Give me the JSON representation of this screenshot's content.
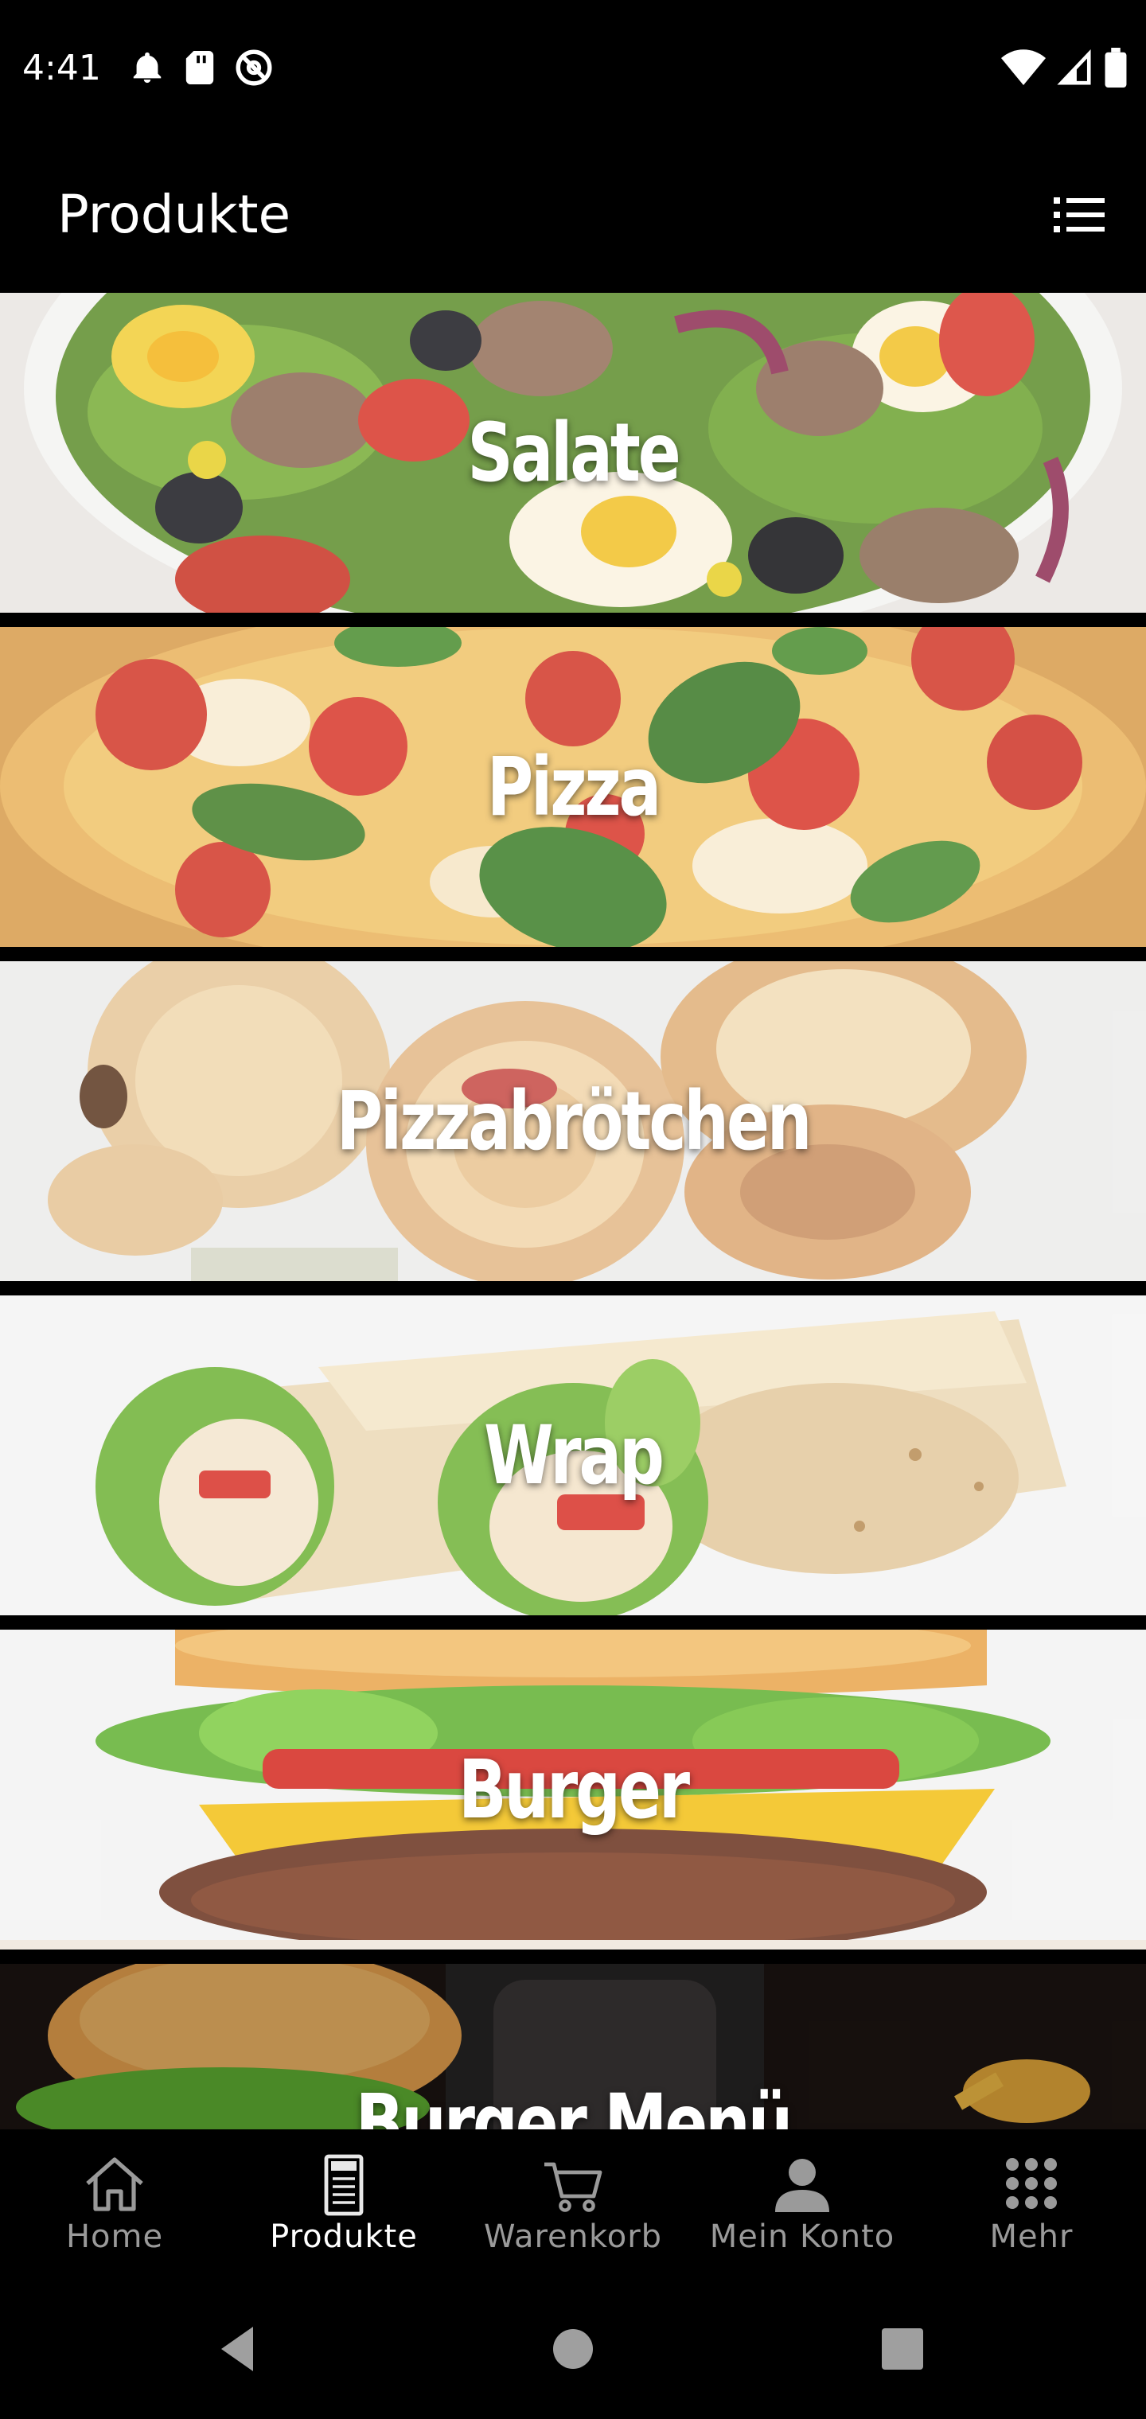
{
  "status_bar": {
    "time": "4:41"
  },
  "app_bar": {
    "title": "Produkte",
    "menu_icon": "list-icon"
  },
  "categories": [
    {
      "label": "Salate",
      "theme": "salad"
    },
    {
      "label": "Pizza",
      "theme": "pizza"
    },
    {
      "label": "Pizzabrötchen",
      "theme": "rolls"
    },
    {
      "label": "Wrap",
      "theme": "wrap"
    },
    {
      "label": "Burger",
      "theme": "burger"
    },
    {
      "label": "Burger Menü",
      "theme": "burger-menu"
    }
  ],
  "bottom_nav": {
    "items": [
      {
        "label": "Home",
        "icon": "home-icon",
        "active": false
      },
      {
        "label": "Produkte",
        "icon": "menu-card-icon",
        "active": true
      },
      {
        "label": "Warenkorb",
        "icon": "cart-icon",
        "active": false
      },
      {
        "label": "Mein Konto",
        "icon": "person-icon",
        "active": false
      },
      {
        "label": "Mehr",
        "icon": "grid-dots-icon",
        "active": false
      }
    ],
    "active_color": "#ffffff",
    "inactive_color": "#9a9a9a"
  },
  "system_nav": {
    "buttons": [
      "back-icon",
      "home-circle-icon",
      "recents-square-icon"
    ]
  }
}
